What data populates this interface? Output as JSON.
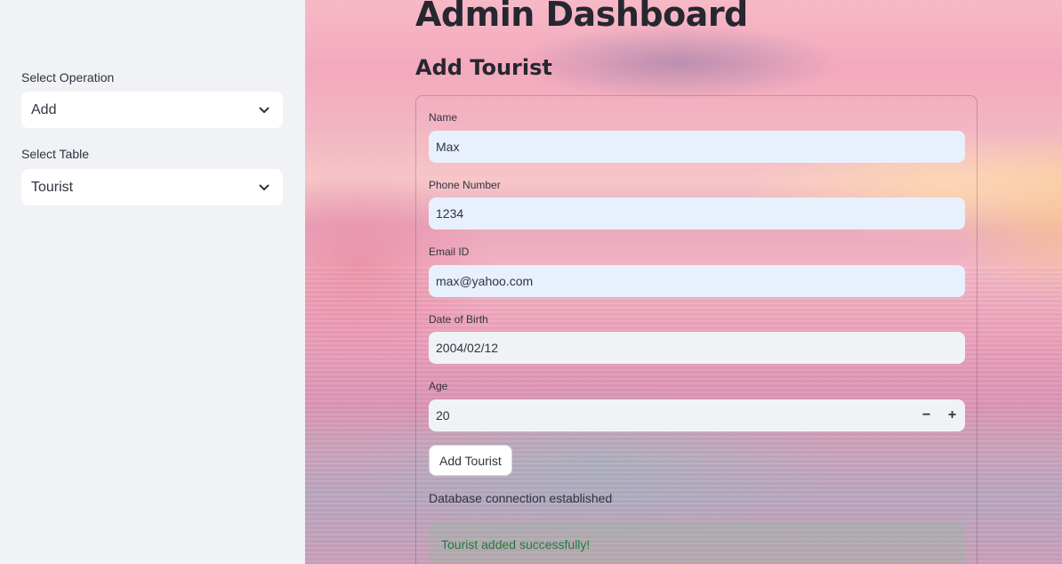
{
  "sidebar": {
    "operation_label": "Select Operation",
    "operation_value": "Add",
    "table_label": "Select Table",
    "table_value": "Tourist"
  },
  "main": {
    "title": "Admin Dashboard",
    "subtitle": "Add Tourist",
    "form": {
      "name_label": "Name",
      "name_value": "Max",
      "phone_label": "Phone Number",
      "phone_value": "1234",
      "email_label": "Email ID",
      "email_value": "max@yahoo.com",
      "dob_label": "Date of Birth",
      "dob_value": "2004/02/12",
      "age_label": "Age",
      "age_value": "20",
      "minus_symbol": "−",
      "plus_symbol": "+",
      "submit_label": "Add Tourist"
    },
    "status_message": "Database connection established",
    "success_message": "Tourist added successfully!"
  },
  "icons": {
    "dropdown": "chevron-down-icon",
    "decrement": "minus-icon",
    "increment": "plus-icon"
  },
  "colors": {
    "sidebar_bg": "#f0f2f6",
    "input_autofill_bg": "#e8f0fe",
    "input_bg": "#f0f2f6",
    "success_text": "#1f7a3a"
  }
}
